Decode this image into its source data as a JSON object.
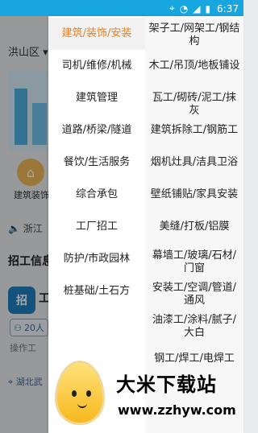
{
  "status_bar": {
    "time": "6:37",
    "icons": [
      "location-icon",
      "wifi-icon",
      "signal-icon",
      "battery-icon"
    ]
  },
  "background": {
    "region": "洪山区",
    "category_label": "建筑装饰",
    "announce_label": "浙江",
    "section_title": "招工信息",
    "badge_letter": "招",
    "card_title": "工",
    "people_count": "20人",
    "worktype": "操作工",
    "location": "湖北武"
  },
  "left_categories": [
    {
      "label": "建筑/装饰/安装",
      "active": true
    },
    {
      "label": "司机/维修/机械",
      "active": false
    },
    {
      "label": "建筑管理",
      "active": false
    },
    {
      "label": "道路/桥梁/隧道",
      "active": false
    },
    {
      "label": "餐饮/生活服务",
      "active": false
    },
    {
      "label": "综合承包",
      "active": false
    },
    {
      "label": "工厂招工",
      "active": false
    },
    {
      "label": "防护/市政园林",
      "active": false
    },
    {
      "label": "桩基础/土石方",
      "active": false
    }
  ],
  "right_items": [
    "架子工/网架工/钢结构",
    "木工/吊顶/地板铺设",
    "瓦工/砌砖/泥工/抹灰",
    "建筑拆除工/钢筋工",
    "烟机灶具/洁具卫浴",
    "壁纸铺贴/家具安装",
    "美缝/打板/铝膜",
    "幕墙工/玻璃/石材/门窗",
    "安装工/空调/管道/通风",
    "油漆工/涂料/腻子/大白",
    "钢工/焊工/电焊工"
  ],
  "watermark": {
    "title": "大米下载站",
    "url": "www.zzhyw.com"
  }
}
